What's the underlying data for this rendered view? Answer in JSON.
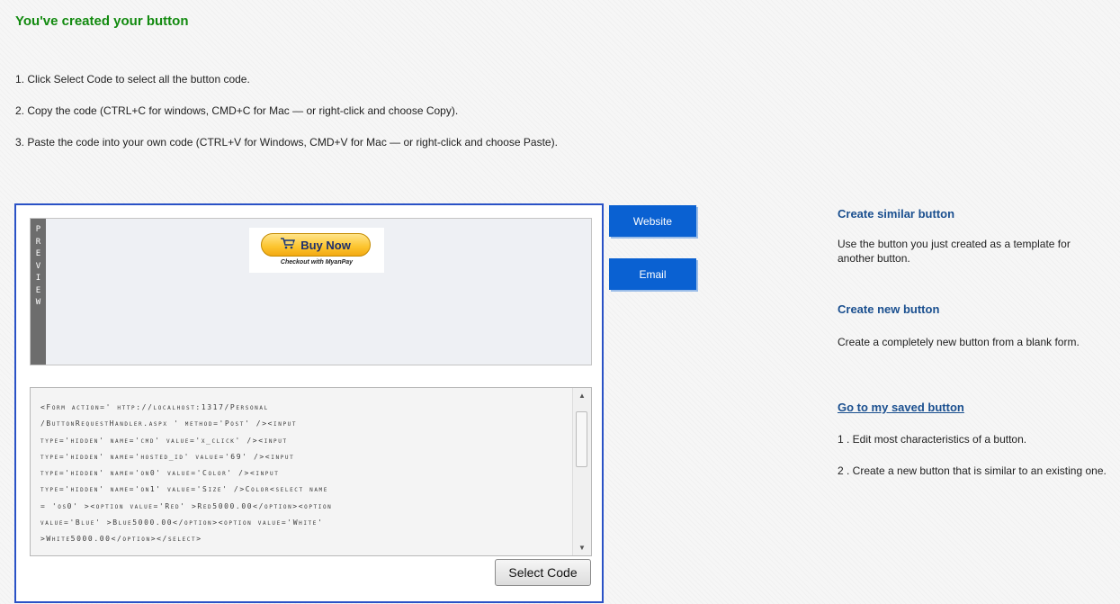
{
  "header": {
    "title": "You've created your button"
  },
  "steps": [
    "1. Click Select Code to select all the button code.",
    "2. Copy the code (CTRL+C for windows, CMD+C for Mac — or right-click and choose Copy).",
    "3. Paste the code into your own code (CTRL+V for Windows, CMD+V for Mac — or right-click and choose Paste)."
  ],
  "preview": {
    "tab_label": "PREVIEW",
    "button_label": "Buy Now",
    "button_subtext": "Checkout with MyanPay",
    "icon": "cart-icon"
  },
  "code": {
    "text": "<Form action=' http://localhost:1317/Personal\n/ButtonRequestHandler.aspx ' method='Post' /><input\ntype='hidden' name='cmd' value='x_click' /><input\ntype='hidden' name='hosted_id' value='69' /><input\ntype='hidden' name='on0' value='Color' /><input\ntype='hidden' name='on1' value='Size' />Color<select name\n= 'os0' ><option value='Red' >Red5000.00</option><option\nvalue='Blue' >Blue5000.00</option><option value='White'\n>White5000.00</option></select>"
  },
  "actions": {
    "select_code": "Select Code",
    "website": "Website",
    "email": "Email"
  },
  "sidebar": {
    "similar_title": "Create similar button",
    "similar_desc": "Use the button you just created as a template for another button.",
    "new_title": "Create new button",
    "new_desc": "Create a completely new button from a blank form.",
    "saved_link": "Go to my saved button",
    "saved_item1": "1 . Edit most characteristics of a button.",
    "saved_item2": "2 . Create a new button that is similar to an existing one."
  },
  "colors": {
    "title_green": "#128a0f",
    "panel_border": "#2a52c6",
    "side_button_blue": "#0a61d2",
    "link_blue": "#1a4f8f"
  }
}
